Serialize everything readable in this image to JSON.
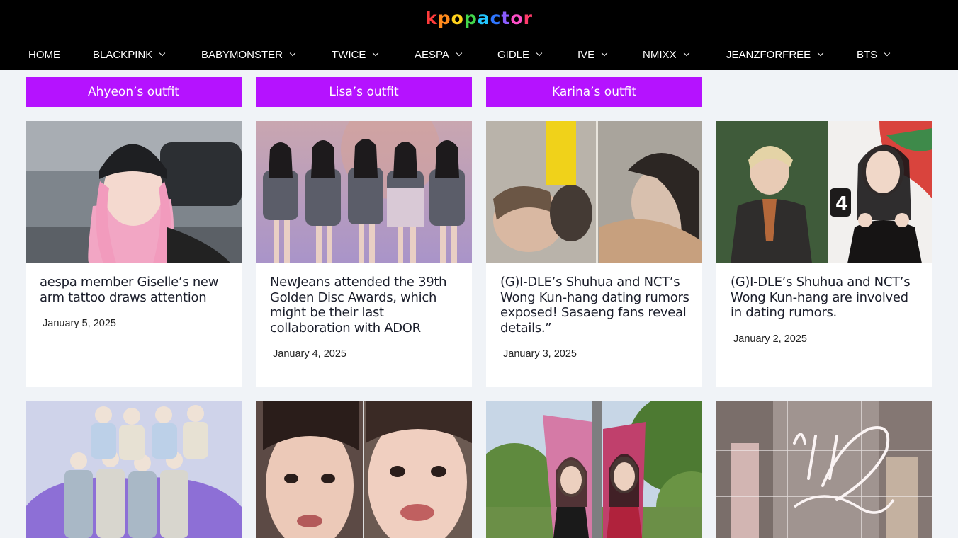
{
  "site": {
    "logo_letters": [
      "k",
      "p",
      "o",
      "p",
      "a",
      "c",
      "t",
      "o",
      "r"
    ],
    "logo_colors": [
      "#ff3b3b",
      "#ff8a1c",
      "#ffd21c",
      "#41d64b",
      "#23c6ff",
      "#2f76ff",
      "#8b5cff",
      "#ff4fc8",
      "#ff3b6b"
    ]
  },
  "nav": {
    "items": [
      {
        "label": "HOME",
        "dropdown": false
      },
      {
        "label": "BLACKPINK",
        "dropdown": true
      },
      {
        "label": "BABYMONSTER",
        "dropdown": true
      },
      {
        "label": "TWICE",
        "dropdown": true
      },
      {
        "label": "AESPA",
        "dropdown": true
      },
      {
        "label": "GIDLE",
        "dropdown": true
      },
      {
        "label": "IVE",
        "dropdown": true
      },
      {
        "label": "NMIXX",
        "dropdown": true
      },
      {
        "label": "JEANZFORFREE",
        "dropdown": true
      },
      {
        "label": "BTS",
        "dropdown": true
      }
    ]
  },
  "outfits": [
    {
      "label": "Ahyeon’s outfit"
    },
    {
      "label": "Lisa’s outfit"
    },
    {
      "label": "Karina’s outfit"
    }
  ],
  "articles": [
    {
      "title": "aespa member Giselle’s new arm tattoo draws attention",
      "date": "January 5, 2025"
    },
    {
      "title": "NewJeans attended the 39th Golden Disc Awards, which might be their last collaboration with ADOR",
      "date": "January 4, 2025"
    },
    {
      "title": "(G)I-DLE’s Shuhua and NCT’s Wong Kun-hang dating rumors exposed! Sasaeng fans reveal details.”",
      "date": "January 3, 2025"
    },
    {
      "title": "(G)I-DLE’s Shuhua and NCT’s Wong Kun-hang are involved in dating rumors.",
      "date": "January 2, 2025"
    }
  ],
  "colors": {
    "accent": "#b512ff",
    "header_bg": "#000000",
    "page_bg": "#f0f3f7"
  }
}
